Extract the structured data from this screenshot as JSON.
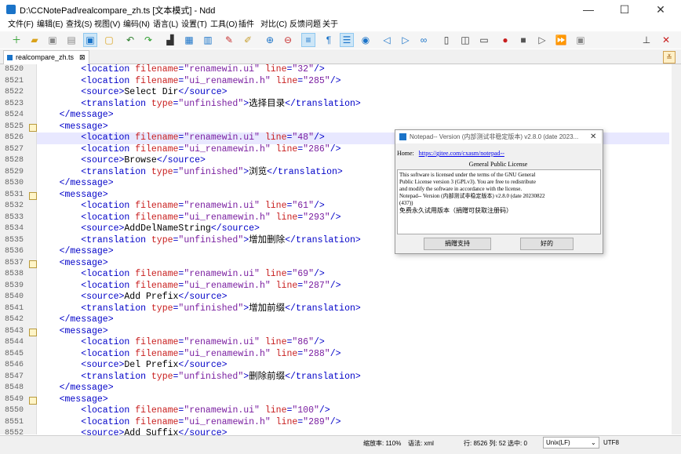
{
  "window": {
    "title": "D:\\CCNotePad\\realcompare_zh.ts [文本模式] - Ndd",
    "minimize": "—",
    "maximize": "☐",
    "close": "✕"
  },
  "menu": [
    "文件(F)",
    "编辑(E)",
    "查找(S)",
    "视图(V)",
    "编码(N)",
    "语言(L)",
    "设置(T)",
    "工具(O)",
    "插件",
    "对比(C)",
    "反馈问题",
    "关于"
  ],
  "tab": {
    "label": "realcompare_zh.ts",
    "close": "⊠"
  },
  "toolbar_icons": [
    "new-file",
    "open-file",
    "save",
    "save-all",
    "compare",
    "close",
    "reload",
    "undo",
    "redo",
    "find",
    "cut",
    "copy",
    "zoom-in",
    "zoom-out",
    "word-wrap",
    "show-symbols",
    "indent-guide",
    "show-all",
    "prev",
    "next",
    "go-to",
    "split",
    "compare-view",
    "monitor",
    "record",
    "stop",
    "play",
    "play-many",
    "save-macro",
    "pin",
    "close-app"
  ],
  "editor": {
    "lines": [
      {
        "n": "8520",
        "fold": false,
        "hl": false,
        "indent": 8,
        "parts": [
          [
            "tag",
            "<location "
          ],
          [
            "attr",
            "filename"
          ],
          [
            "tag",
            "="
          ],
          [
            "val",
            "\"renamewin.ui\""
          ],
          [
            "tag",
            " "
          ],
          [
            "attr",
            "line"
          ],
          [
            "tag",
            "="
          ],
          [
            "val",
            "\"32\""
          ],
          [
            "tag",
            "/>"
          ]
        ]
      },
      {
        "n": "8521",
        "fold": false,
        "hl": false,
        "indent": 8,
        "parts": [
          [
            "tag",
            "<location "
          ],
          [
            "attr",
            "filename"
          ],
          [
            "tag",
            "="
          ],
          [
            "val",
            "\"ui_renamewin.h\""
          ],
          [
            "tag",
            " "
          ],
          [
            "attr",
            "line"
          ],
          [
            "tag",
            "="
          ],
          [
            "val",
            "\"285\""
          ],
          [
            "tag",
            "/>"
          ]
        ]
      },
      {
        "n": "8522",
        "fold": false,
        "hl": false,
        "indent": 8,
        "parts": [
          [
            "tag",
            "<source>"
          ],
          [
            "txt",
            "Select Dir"
          ],
          [
            "tag",
            "</source>"
          ]
        ]
      },
      {
        "n": "8523",
        "fold": false,
        "hl": false,
        "indent": 8,
        "parts": [
          [
            "tag",
            "<translation "
          ],
          [
            "attr",
            "type"
          ],
          [
            "tag",
            "="
          ],
          [
            "val",
            "\"unfinished\""
          ],
          [
            "tag",
            ">"
          ],
          [
            "txt",
            "选择目录"
          ],
          [
            "tag",
            "</translation>"
          ]
        ]
      },
      {
        "n": "8524",
        "fold": false,
        "hl": false,
        "indent": 4,
        "parts": [
          [
            "tag",
            "</message>"
          ]
        ]
      },
      {
        "n": "8525",
        "fold": true,
        "hl": false,
        "indent": 4,
        "parts": [
          [
            "tag",
            "<message>"
          ]
        ]
      },
      {
        "n": "8526",
        "fold": false,
        "hl": true,
        "indent": 8,
        "parts": [
          [
            "tag",
            "<location "
          ],
          [
            "attr",
            "filename"
          ],
          [
            "tag",
            "="
          ],
          [
            "val",
            "\"renamewin.ui\""
          ],
          [
            "tag",
            " "
          ],
          [
            "attr",
            "line"
          ],
          [
            "tag",
            "="
          ],
          [
            "val",
            "\"48\""
          ],
          [
            "tag",
            "/>"
          ]
        ]
      },
      {
        "n": "8527",
        "fold": false,
        "hl": false,
        "indent": 8,
        "parts": [
          [
            "tag",
            "<location "
          ],
          [
            "attr",
            "filename"
          ],
          [
            "tag",
            "="
          ],
          [
            "val",
            "\"ui_renamewin.h\""
          ],
          [
            "tag",
            " "
          ],
          [
            "attr",
            "line"
          ],
          [
            "tag",
            "="
          ],
          [
            "val",
            "\"286\""
          ],
          [
            "tag",
            "/>"
          ]
        ]
      },
      {
        "n": "8528",
        "fold": false,
        "hl": false,
        "indent": 8,
        "parts": [
          [
            "tag",
            "<source>"
          ],
          [
            "txt",
            "Browse"
          ],
          [
            "tag",
            "</source>"
          ]
        ]
      },
      {
        "n": "8529",
        "fold": false,
        "hl": false,
        "indent": 8,
        "parts": [
          [
            "tag",
            "<translation "
          ],
          [
            "attr",
            "type"
          ],
          [
            "tag",
            "="
          ],
          [
            "val",
            "\"unfinished\""
          ],
          [
            "tag",
            ">"
          ],
          [
            "txt",
            "浏览"
          ],
          [
            "tag",
            "</translation>"
          ]
        ]
      },
      {
        "n": "8530",
        "fold": false,
        "hl": false,
        "indent": 4,
        "parts": [
          [
            "tag",
            "</message>"
          ]
        ]
      },
      {
        "n": "8531",
        "fold": true,
        "hl": false,
        "indent": 4,
        "parts": [
          [
            "tag",
            "<message>"
          ]
        ]
      },
      {
        "n": "8532",
        "fold": false,
        "hl": false,
        "indent": 8,
        "parts": [
          [
            "tag",
            "<location "
          ],
          [
            "attr",
            "filename"
          ],
          [
            "tag",
            "="
          ],
          [
            "val",
            "\"renamewin.ui\""
          ],
          [
            "tag",
            " "
          ],
          [
            "attr",
            "line"
          ],
          [
            "tag",
            "="
          ],
          [
            "val",
            "\"61\""
          ],
          [
            "tag",
            "/>"
          ]
        ]
      },
      {
        "n": "8533",
        "fold": false,
        "hl": false,
        "indent": 8,
        "parts": [
          [
            "tag",
            "<location "
          ],
          [
            "attr",
            "filename"
          ],
          [
            "tag",
            "="
          ],
          [
            "val",
            "\"ui_renamewin.h\""
          ],
          [
            "tag",
            " "
          ],
          [
            "attr",
            "line"
          ],
          [
            "tag",
            "="
          ],
          [
            "val",
            "\"293\""
          ],
          [
            "tag",
            "/>"
          ]
        ]
      },
      {
        "n": "8534",
        "fold": false,
        "hl": false,
        "indent": 8,
        "parts": [
          [
            "tag",
            "<source>"
          ],
          [
            "txt",
            "AddDelNameString"
          ],
          [
            "tag",
            "</source>"
          ]
        ]
      },
      {
        "n": "8535",
        "fold": false,
        "hl": false,
        "indent": 8,
        "parts": [
          [
            "tag",
            "<translation "
          ],
          [
            "attr",
            "type"
          ],
          [
            "tag",
            "="
          ],
          [
            "val",
            "\"unfinished\""
          ],
          [
            "tag",
            ">"
          ],
          [
            "txt",
            "增加删除"
          ],
          [
            "tag",
            "</translation>"
          ]
        ]
      },
      {
        "n": "8536",
        "fold": false,
        "hl": false,
        "indent": 4,
        "parts": [
          [
            "tag",
            "</message>"
          ]
        ]
      },
      {
        "n": "8537",
        "fold": true,
        "hl": false,
        "indent": 4,
        "parts": [
          [
            "tag",
            "<message>"
          ]
        ]
      },
      {
        "n": "8538",
        "fold": false,
        "hl": false,
        "indent": 8,
        "parts": [
          [
            "tag",
            "<location "
          ],
          [
            "attr",
            "filename"
          ],
          [
            "tag",
            "="
          ],
          [
            "val",
            "\"renamewin.ui\""
          ],
          [
            "tag",
            " "
          ],
          [
            "attr",
            "line"
          ],
          [
            "tag",
            "="
          ],
          [
            "val",
            "\"69\""
          ],
          [
            "tag",
            "/>"
          ]
        ]
      },
      {
        "n": "8539",
        "fold": false,
        "hl": false,
        "indent": 8,
        "parts": [
          [
            "tag",
            "<location "
          ],
          [
            "attr",
            "filename"
          ],
          [
            "tag",
            "="
          ],
          [
            "val",
            "\"ui_renamewin.h\""
          ],
          [
            "tag",
            " "
          ],
          [
            "attr",
            "line"
          ],
          [
            "tag",
            "="
          ],
          [
            "val",
            "\"287\""
          ],
          [
            "tag",
            "/>"
          ]
        ]
      },
      {
        "n": "8540",
        "fold": false,
        "hl": false,
        "indent": 8,
        "parts": [
          [
            "tag",
            "<source>"
          ],
          [
            "txt",
            "Add Prefix"
          ],
          [
            "tag",
            "</source>"
          ]
        ]
      },
      {
        "n": "8541",
        "fold": false,
        "hl": false,
        "indent": 8,
        "parts": [
          [
            "tag",
            "<translation "
          ],
          [
            "attr",
            "type"
          ],
          [
            "tag",
            "="
          ],
          [
            "val",
            "\"unfinished\""
          ],
          [
            "tag",
            ">"
          ],
          [
            "txt",
            "增加前缀"
          ],
          [
            "tag",
            "</translation>"
          ]
        ]
      },
      {
        "n": "8542",
        "fold": false,
        "hl": false,
        "indent": 4,
        "parts": [
          [
            "tag",
            "</message>"
          ]
        ]
      },
      {
        "n": "8543",
        "fold": true,
        "hl": false,
        "indent": 4,
        "parts": [
          [
            "tag",
            "<message>"
          ]
        ]
      },
      {
        "n": "8544",
        "fold": false,
        "hl": false,
        "indent": 8,
        "parts": [
          [
            "tag",
            "<location "
          ],
          [
            "attr",
            "filename"
          ],
          [
            "tag",
            "="
          ],
          [
            "val",
            "\"renamewin.ui\""
          ],
          [
            "tag",
            " "
          ],
          [
            "attr",
            "line"
          ],
          [
            "tag",
            "="
          ],
          [
            "val",
            "\"86\""
          ],
          [
            "tag",
            "/>"
          ]
        ]
      },
      {
        "n": "8545",
        "fold": false,
        "hl": false,
        "indent": 8,
        "parts": [
          [
            "tag",
            "<location "
          ],
          [
            "attr",
            "filename"
          ],
          [
            "tag",
            "="
          ],
          [
            "val",
            "\"ui_renamewin.h\""
          ],
          [
            "tag",
            " "
          ],
          [
            "attr",
            "line"
          ],
          [
            "tag",
            "="
          ],
          [
            "val",
            "\"288\""
          ],
          [
            "tag",
            "/>"
          ]
        ]
      },
      {
        "n": "8546",
        "fold": false,
        "hl": false,
        "indent": 8,
        "parts": [
          [
            "tag",
            "<source>"
          ],
          [
            "txt",
            "Del Prefix"
          ],
          [
            "tag",
            "</source>"
          ]
        ]
      },
      {
        "n": "8547",
        "fold": false,
        "hl": false,
        "indent": 8,
        "parts": [
          [
            "tag",
            "<translation "
          ],
          [
            "attr",
            "type"
          ],
          [
            "tag",
            "="
          ],
          [
            "val",
            "\"unfinished\""
          ],
          [
            "tag",
            ">"
          ],
          [
            "txt",
            "删除前缀"
          ],
          [
            "tag",
            "</translation>"
          ]
        ]
      },
      {
        "n": "8548",
        "fold": false,
        "hl": false,
        "indent": 4,
        "parts": [
          [
            "tag",
            "</message>"
          ]
        ]
      },
      {
        "n": "8549",
        "fold": true,
        "hl": false,
        "indent": 4,
        "parts": [
          [
            "tag",
            "<message>"
          ]
        ]
      },
      {
        "n": "8550",
        "fold": false,
        "hl": false,
        "indent": 8,
        "parts": [
          [
            "tag",
            "<location "
          ],
          [
            "attr",
            "filename"
          ],
          [
            "tag",
            "="
          ],
          [
            "val",
            "\"renamewin.ui\""
          ],
          [
            "tag",
            " "
          ],
          [
            "attr",
            "line"
          ],
          [
            "tag",
            "="
          ],
          [
            "val",
            "\"100\""
          ],
          [
            "tag",
            "/>"
          ]
        ]
      },
      {
        "n": "8551",
        "fold": false,
        "hl": false,
        "indent": 8,
        "parts": [
          [
            "tag",
            "<location "
          ],
          [
            "attr",
            "filename"
          ],
          [
            "tag",
            "="
          ],
          [
            "val",
            "\"ui_renamewin.h\""
          ],
          [
            "tag",
            " "
          ],
          [
            "attr",
            "line"
          ],
          [
            "tag",
            "="
          ],
          [
            "val",
            "\"289\""
          ],
          [
            "tag",
            "/>"
          ]
        ]
      },
      {
        "n": "8552",
        "fold": false,
        "hl": false,
        "indent": 8,
        "parts": [
          [
            "tag",
            "<source>"
          ],
          [
            "txt",
            "Add Suffix"
          ],
          [
            "tag",
            "</source>"
          ]
        ]
      }
    ]
  },
  "dialog": {
    "title": "Notepad-- Version (内部测试非稳定版本) v2.8.0 (date 2023...",
    "close": "✕",
    "home_label": "Home:",
    "home_link": "https://gitee.com/cxasm/notepad--",
    "license_heading": "General Public License",
    "body_lines": [
      "This software is licensed under the terms of the GNU General",
      "Public License version 3 (GPLv3). You are free to redistribute",
      "and modify the software in accordance with the license.",
      "Notepad-- Version (内部测试非稳定版本) v2.8.0 (date 20230822",
      "(437))",
      "免费永久试用版本（捐赠可获取注册码）"
    ],
    "donate_button": "捐赠支持",
    "ok_button": "好的"
  },
  "status": {
    "zoom": "缩放率: 110%",
    "syntax": "语法: xml",
    "position": "行: 8526 列: 52 选中: 0",
    "eol": "Unix(LF)",
    "encoding": "UTF8"
  },
  "colors": {
    "tag": "#0000c8",
    "attr": "#c81e1e",
    "value": "#7a1ea0",
    "current_line": "#e8e8ff"
  }
}
